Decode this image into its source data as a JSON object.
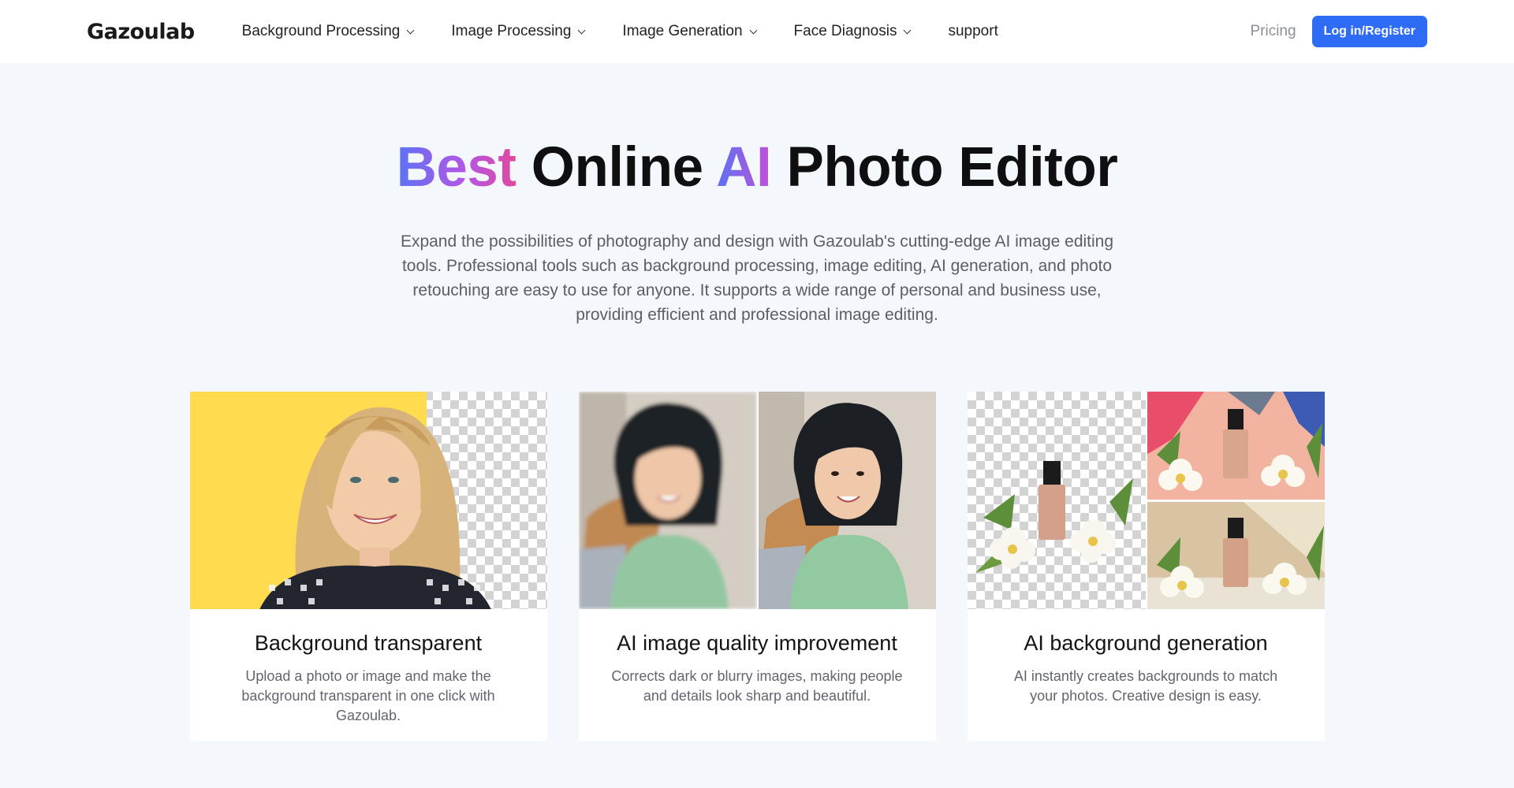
{
  "header": {
    "logo": "Gazoulab",
    "nav": [
      {
        "label": "Background Processing",
        "dropdown": true
      },
      {
        "label": "Image Processing",
        "dropdown": true
      },
      {
        "label": "Image Generation",
        "dropdown": true
      },
      {
        "label": "Face Diagnosis",
        "dropdown": true
      },
      {
        "label": "support",
        "dropdown": false
      }
    ],
    "pricing": "Pricing",
    "login": "Log in/Register"
  },
  "hero": {
    "title_word1": "Best",
    "title_word2": "Online",
    "title_word3": "AI",
    "title_word4": "Photo Editor",
    "description": "Expand the possibilities of photography and design with Gazoulab's cutting-edge AI image editing tools. Professional tools such as background processing, image editing, AI generation, and photo retouching are easy to use for anyone. It supports a wide range of personal and business use, providing efficient and professional image editing."
  },
  "cards": [
    {
      "title": "Background transparent",
      "desc": "Upload a photo or image and make the background transparent in one click with Gazoulab."
    },
    {
      "title": "AI image quality improvement",
      "desc": "Corrects dark or blurry images, making people and details look sharp and beautiful."
    },
    {
      "title": "AI background generation",
      "desc": "AI instantly creates backgrounds to match your photos. Creative design is easy."
    }
  ],
  "colors": {
    "accent": "#2f6cf5",
    "page_bg": "#f4f7fc",
    "gradient": [
      "#5b73f3",
      "#b057e6",
      "#e0499f"
    ]
  }
}
